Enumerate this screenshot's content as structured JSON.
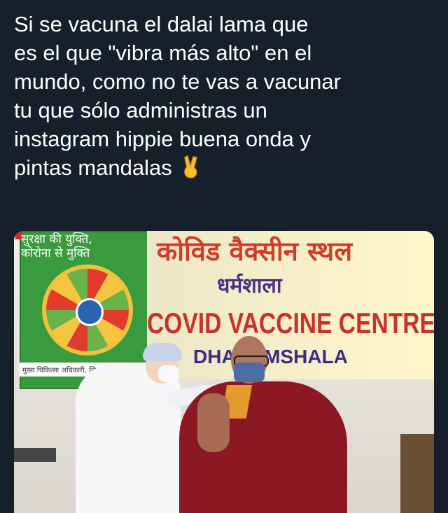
{
  "post": {
    "lines": [
      "Si se vacuna el dalai lama que",
      "es el que \"vibra más alto\" en el",
      "mundo, como no te vas a vacunar",
      "tu que sólo administras un",
      "instagram hippie buena onda y",
      "pintas mandalas"
    ],
    "emoji": "victory-hand"
  },
  "photo": {
    "poster_title_line1": "सुरक्षा की युक्ति,",
    "poster_title_line2": "कोरोना से मुक्ति",
    "poster_strip": "मुख्य चिकित्सा अधिकारी, जिला कांग",
    "banner_hindi_line1": "कोविड वैक्सीन स्थल",
    "banner_hindi_line2": "धर्मशाला",
    "banner_english_line1": "COVID VACCINE CENTRE",
    "banner_english_line2": "DHARAMSHALA"
  },
  "colors": {
    "background": "#15202b",
    "text": "#ffffff",
    "robe": "#8b1823",
    "poster_green": "#3a9a3e"
  }
}
